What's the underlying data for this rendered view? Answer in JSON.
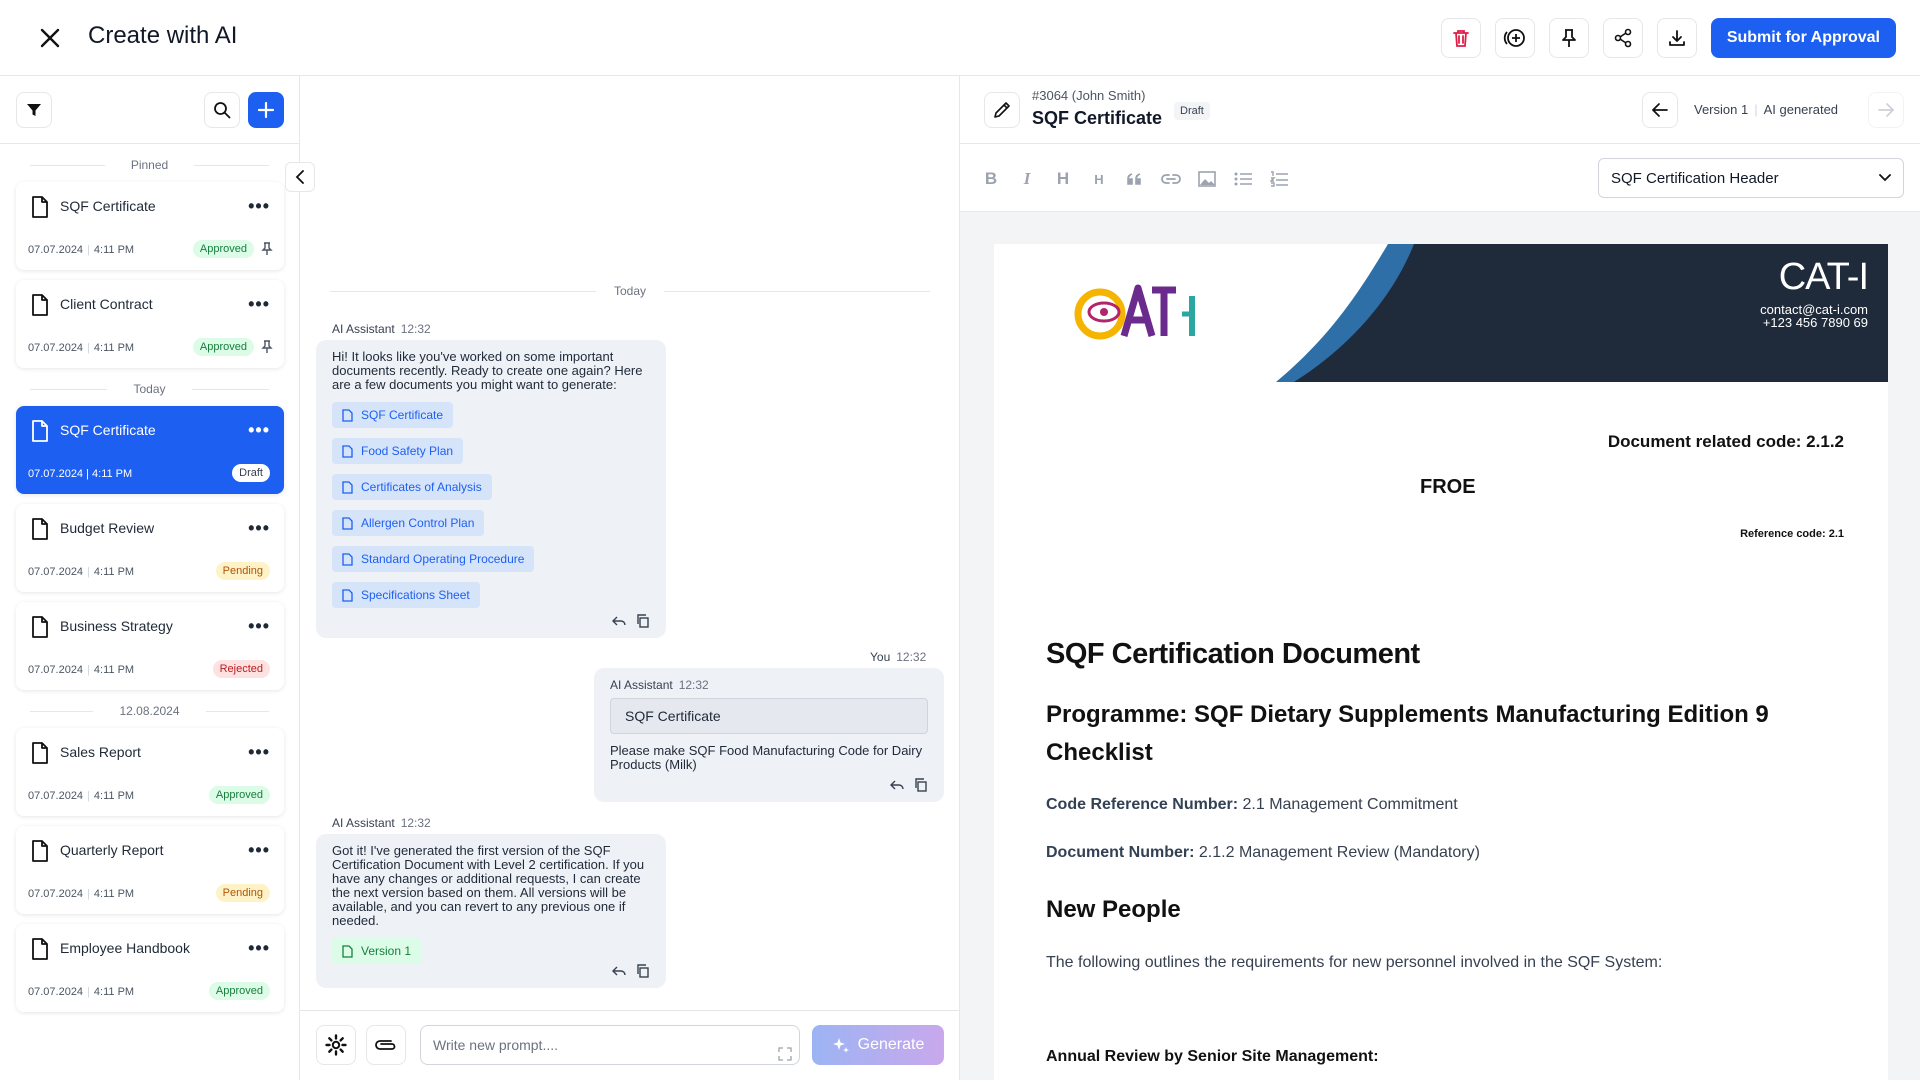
{
  "app": {
    "title": "Create with AI",
    "submit_label": "Submit for Approval"
  },
  "colors": {
    "accent": "#1d5ff0",
    "danger": "#e11d48",
    "banner_dark": "#1f2a3a",
    "banner_blue": "#2e6fa8"
  },
  "sidebar": {
    "groups": {
      "pinned": "Pinned",
      "today": "Today",
      "date": "12.08.2024"
    },
    "pinned": [
      {
        "title": "SQF Certificate",
        "date": "07.07.2024",
        "time": "4:11 PM",
        "status": "Approved"
      },
      {
        "title": "Client Contract",
        "date": "07.07.2024",
        "time": "4:11 PM",
        "status": "Approved"
      }
    ],
    "today": [
      {
        "title": "SQF Certificate",
        "datetime": "07.07.2024 | 4:11 PM",
        "status": "Draft"
      },
      {
        "title": "Budget Review",
        "date": "07.07.2024",
        "time": "4:11 PM",
        "status": "Pending"
      },
      {
        "title": "Business Strategy",
        "date": "07.07.2024",
        "time": "4:11 PM",
        "status": "Rejected"
      }
    ],
    "dated": [
      {
        "title": "Sales Report",
        "date": "07.07.2024",
        "time": "4:11 PM",
        "status": "Approved"
      },
      {
        "title": "Quarterly Report",
        "date": "07.07.2024",
        "time": "4:11 PM",
        "status": "Pending"
      },
      {
        "title": "Employee Handbook",
        "date": "07.07.2024",
        "time": "4:11 PM",
        "status": "Approved"
      }
    ],
    "more_glyph": "•••"
  },
  "chat": {
    "day": "Today",
    "messages": [
      {
        "author": "AI Assistant",
        "time": "12:32",
        "text": "Hi! It looks like you've worked on some important documents recently. Ready to create one again? Here are a few documents you might want to generate:",
        "chips": [
          "SQF Certificate",
          "Food Safety Plan",
          "Certificates of Analysis",
          "Allergen Control Plan",
          "Standard Operating Procedure",
          "Specifications Sheet"
        ]
      },
      {
        "author": "You",
        "time": "12:32",
        "quote_author": "AI Assistant",
        "quote_time": "12:32",
        "quote": "SQF Certificate",
        "text": "Please make SQF Food Manufacturing Code for Dairy Products (Milk)"
      },
      {
        "author": "AI Assistant",
        "time": "12:32",
        "text": "Got it! I've generated the first version of the SQF Certification Document with Level 2 certification. If you have any changes or additional requests, I can create the next version based on them. All versions will be available, and you can revert to any previous one if needed.",
        "chips": [
          "Version 1"
        ]
      }
    ],
    "composer": {
      "placeholder": "Write new prompt....",
      "generate_label": "Generate"
    }
  },
  "editor": {
    "doc_id": "#3064 (John Smith)",
    "doc_name": "SQF Certificate",
    "status": "Draft",
    "version": "Version 1",
    "version_source": "AI generated",
    "section": "SQF Certification Header",
    "tools": [
      "B",
      "I",
      "H",
      "H"
    ],
    "page": {
      "brand": "CAT-I",
      "brand_email": "contact@cat-i.com",
      "brand_phone": "+123 456 7890 69",
      "related_code": "Document related code: 2.1.2",
      "froe": "FROE",
      "reference_code": "Reference code: 2.1",
      "title": "SQF Certification Document",
      "programme": "Programme: SQF Dietary Supplements Manufacturing Edition 9 Checklist",
      "code_ref_label": "Code Reference Number:",
      "code_ref_value": "2.1 Management Commitment",
      "doc_num_label": "Document Number:",
      "doc_num_value": "2.1.2 Management Review (Mandatory)",
      "section_title": "New People",
      "section_text": "The following outlines the requirements for new personnel involved in the SQF System:",
      "subsection": "Annual Review by Senior Site Management:"
    }
  }
}
